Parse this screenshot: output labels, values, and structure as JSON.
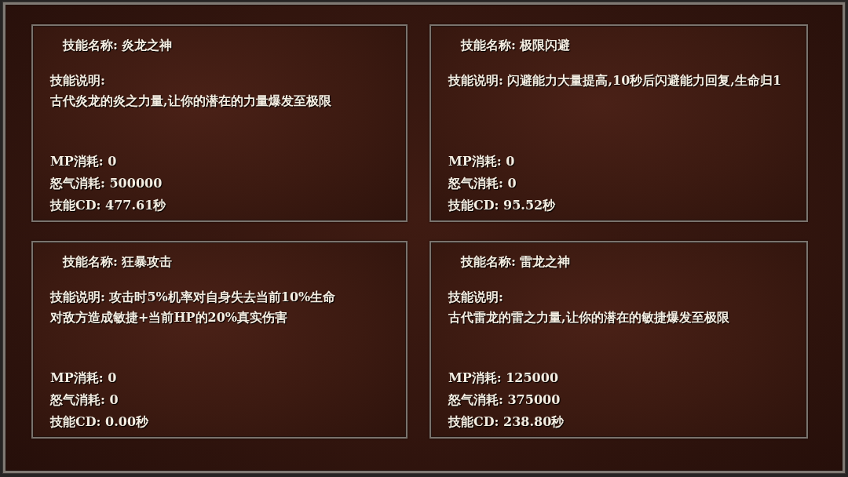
{
  "skills": [
    {
      "name": "技能名称: 炎龙之神",
      "description_lines": [
        "技能说明:",
        "古代炎龙的炎之力量,让你的潜在的力量爆发至极限"
      ],
      "stats": [
        "MP消耗: 0",
        "怒气消耗: 500000",
        "技能CD: 477.61秒"
      ]
    },
    {
      "name": "技能名称: 极限闪避",
      "description_lines": [
        "技能说明: 闪避能力大量提高,10秒后闪避能力回复,生命归1"
      ],
      "stats": [
        "MP消耗: 0",
        "怒气消耗: 0",
        "技能CD: 95.52秒"
      ]
    },
    {
      "name": "技能名称: 狂暴攻击",
      "description_lines": [
        "技能说明: 攻击时5%机率对自身失去当前10%生命",
        "对敌方造成敏捷+当前HP的20%真实伤害"
      ],
      "stats": [
        "MP消耗: 0",
        "怒气消耗: 0",
        "技能CD: 0.00秒"
      ]
    },
    {
      "name": "技能名称: 雷龙之神",
      "description_lines": [
        "技能说明:",
        "古代雷龙的雷之力量,让你的潜在的敏捷爆发至极限"
      ],
      "stats": [
        "MP消耗: 125000",
        "怒气消耗: 375000",
        "技能CD: 238.80秒"
      ]
    }
  ]
}
